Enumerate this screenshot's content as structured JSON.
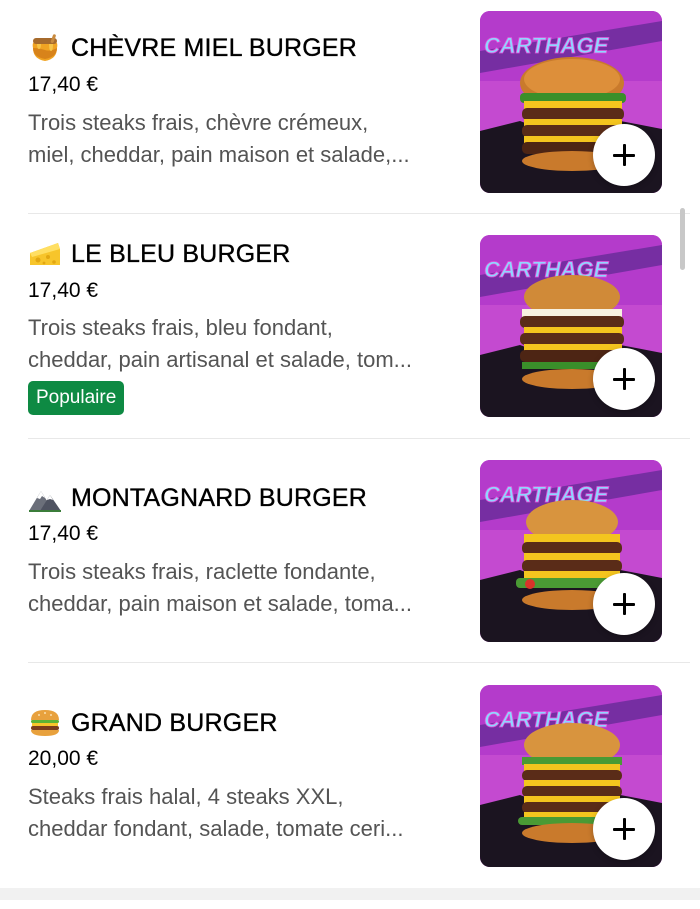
{
  "menu": {
    "items": [
      {
        "emoji": "honey-pot-icon",
        "title": "CHÈVRE MIEL BURGER",
        "price": "17,40 €",
        "description_lines": [
          "Trois steaks frais, chèvre crémeux,",
          "miel, cheddar, pain maison et salade,..."
        ],
        "badge": null,
        "image_text": "CARTHAGE"
      },
      {
        "emoji": "cheese-icon",
        "title": "LE BLEU BURGER",
        "price": "17,40 €",
        "description_lines": [
          "Trois steaks frais, bleu fondant,",
          "cheddar, pain artisanal et salade, tom..."
        ],
        "badge": "Populaire",
        "image_text": "CARTHAGE"
      },
      {
        "emoji": "mountain-icon",
        "title": "MONTAGNARD BURGER",
        "price": "17,40 €",
        "description_lines": [
          "Trois steaks frais, raclette fondante,",
          "cheddar, pain maison et salade, toma..."
        ],
        "badge": null,
        "image_text": "CARTHAGE"
      },
      {
        "emoji": "burger-icon",
        "title": "GRAND BURGER",
        "price": "20,00 €",
        "description_lines": [
          "Steaks frais halal, 4 steaks XXL,",
          "cheddar fondant, salade, tomate ceri..."
        ],
        "badge": null,
        "image_text": "CARTHAGE"
      }
    ]
  },
  "colors": {
    "badge_bg": "#0e8a43",
    "image_bg": "#c44ad0",
    "description_text": "#545454",
    "divider": "#e8e8e8"
  }
}
